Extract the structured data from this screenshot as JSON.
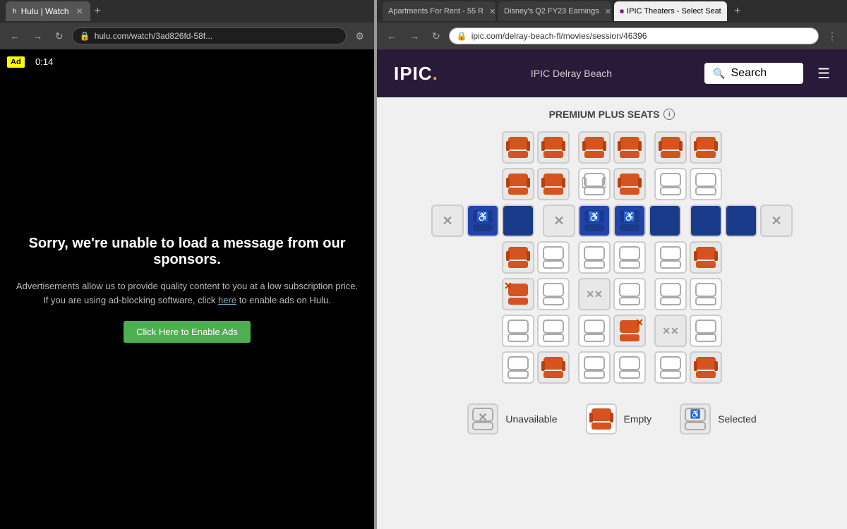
{
  "leftPanel": {
    "tabTitle": "Hulu | Watch",
    "favicon": "h",
    "url": "hulu.com/watch/3ad826fd-58f...",
    "adBadge": "Ad",
    "timer": "0:14",
    "errorHeading": "Sorry, we're unable to load a message from our sponsors.",
    "errorBody": "Advertisements allow us to provide quality content to you at a low subscription price. If you are using ad-blocking software, click ",
    "errorLink": "here",
    "errorBodyEnd": " to enable ads on Hulu.",
    "enableBtnLabel": "Click Here to Enable Ads"
  },
  "rightPanel": {
    "tabs": [
      {
        "label": "Apartments For Rent - 55 R",
        "active": false
      },
      {
        "label": "Disney's Q2 FY23 Earnings",
        "active": false
      },
      {
        "label": "IPIC Theaters - Select Seat",
        "active": true
      }
    ],
    "url": "ipic.com/delray-beach-fl/movies/session/46396",
    "header": {
      "logo": "IPIC",
      "logoDot": ".",
      "location": "IPIC Delray Beach",
      "searchPlaceholder": "Search"
    },
    "seatMap": {
      "sectionTitle": "PREMIUM PLUS SEATS"
    },
    "legend": {
      "unavailable": "Unavailable",
      "empty": "Empty",
      "selected": "Selected"
    }
  }
}
